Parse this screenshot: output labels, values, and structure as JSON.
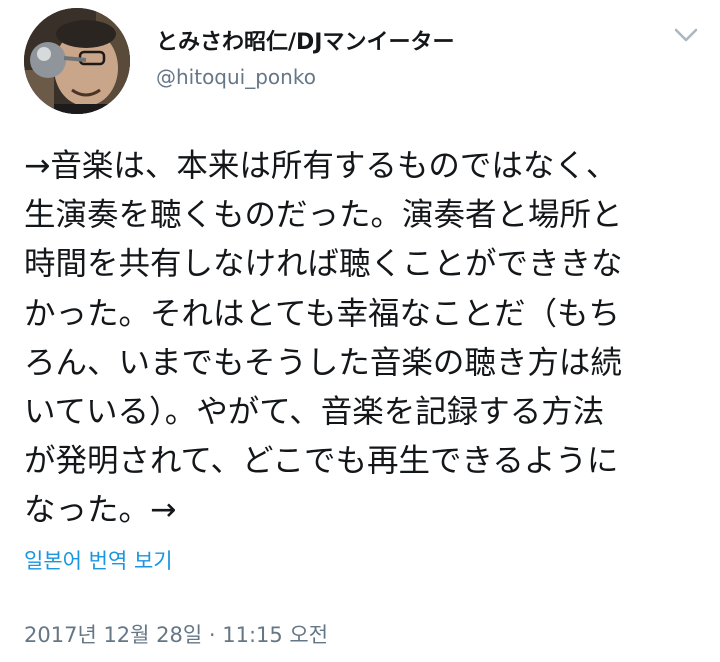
{
  "user": {
    "display_name": "とみさわ昭仁/DJマンイーター",
    "handle": "@hitoqui_ponko",
    "avatar": "profile-photo"
  },
  "menu_icon": "chevron-down-icon",
  "tweet": {
    "lines": [
      "→音楽は、本来は所有するものではなく、",
      "生演奏を聴くものだった。演奏者と場所と",
      "時間を共有しなければ聴くことができきな",
      "かった。それはとても幸福なことだ（もち",
      "ろん、いまでもそうした音楽の聴き方は続",
      "いている）。やがて、音楽を記録する方法",
      "が発明されて、どこでも再生できるように",
      "なった。→"
    ]
  },
  "translate_label": "일본어 번역 보기",
  "timestamp": "2017년 12월 28일 · 11:15 오전",
  "colors": {
    "link": "#1b95e0",
    "secondary_text": "#657786",
    "primary_text": "#14171a",
    "chevron": "#aab8c2"
  }
}
